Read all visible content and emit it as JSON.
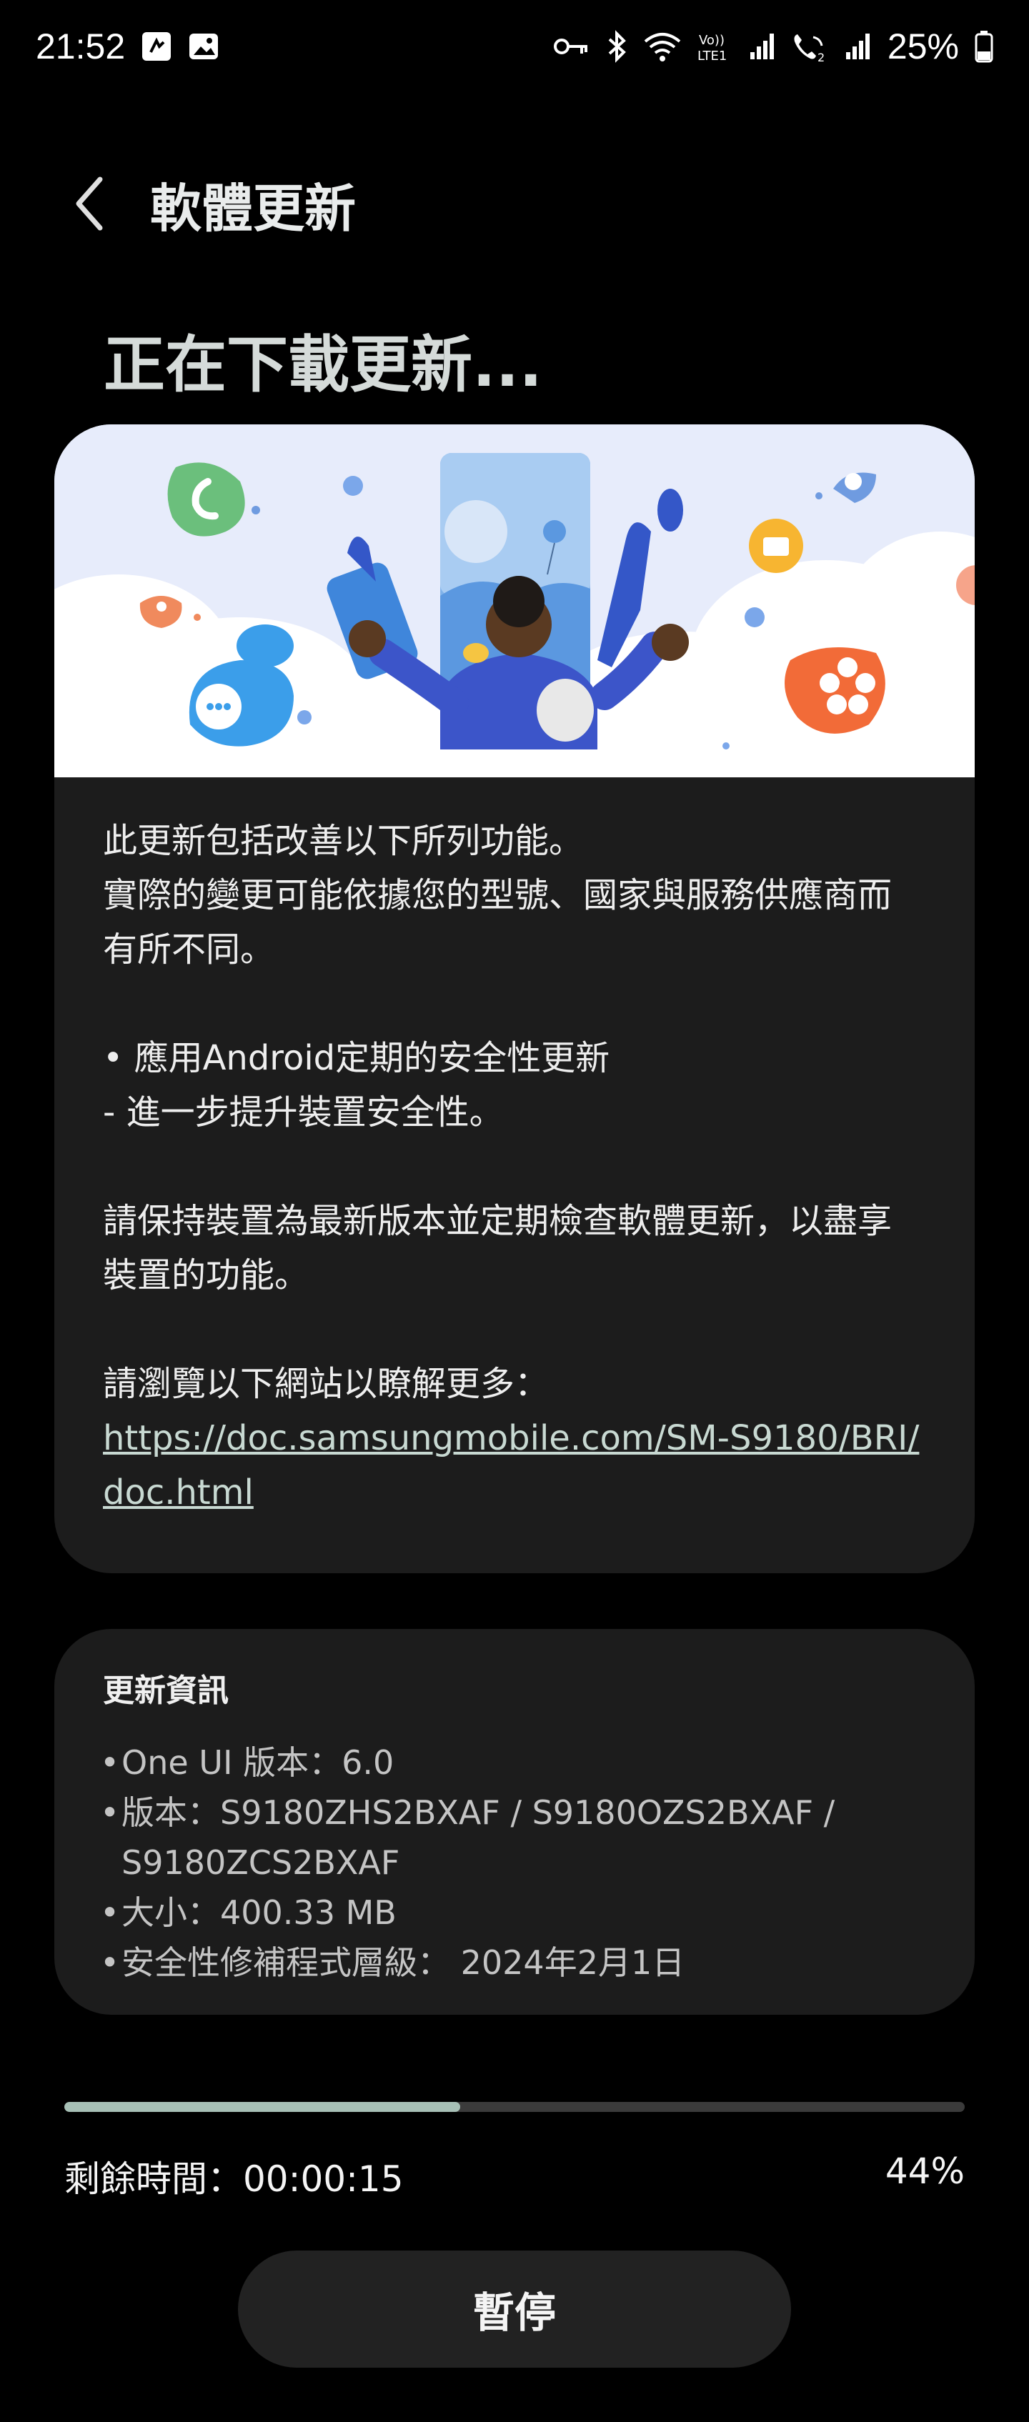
{
  "status_bar": {
    "time": "21:52",
    "battery": "25%",
    "icons": [
      "notification-app-icon",
      "gallery-icon",
      "key-icon",
      "bluetooth-icon",
      "wifi-icon",
      "volte-icon",
      "signal-icon",
      "wifi-calling-icon",
      "signal-icon",
      "battery-icon"
    ],
    "volte_label": "Vo))\nLTE1"
  },
  "header": {
    "title": "軟體更新",
    "back_icon": "chevron-left-icon"
  },
  "status_title": "正在下載更新...",
  "description": {
    "intro": "此更新包括改善以下所列功能。\n實際的變更可能依據您的型號、國家與服務供應商而\n有所不同。",
    "bullet": "• 應用Android定期的安全性更新\n - 進一步提升裝置安全性。",
    "reminder": "請保持裝置為最新版本並定期檢查軟體更新，以盡享\n裝置的功能。",
    "link_intro": "請瀏覽以下網站以瞭解更多：",
    "link": "https://doc.samsungmobile.com/SM-S9180/BRI/doc.html"
  },
  "update_info": {
    "heading": "更新資訊",
    "items": [
      "One UI 版本：6.0",
      "版本：S9180ZHS2BXAF / S9180OZS2BXAF / S9180ZCS2BXAF",
      "大小：400.33 MB",
      "安全性修補程式層級： 2024年2月1日"
    ]
  },
  "progress": {
    "fraction": 0.44,
    "remaining_label": "剩餘時間：00:00:15",
    "percent_label": "44%"
  },
  "pause_label": "暫停",
  "colors": {
    "background": "#000000",
    "card": "#1c1c1c",
    "progress_fill": "#a7c0b6",
    "progress_track": "#3b3b3b",
    "illustration_bg": "#e7ecfb"
  }
}
